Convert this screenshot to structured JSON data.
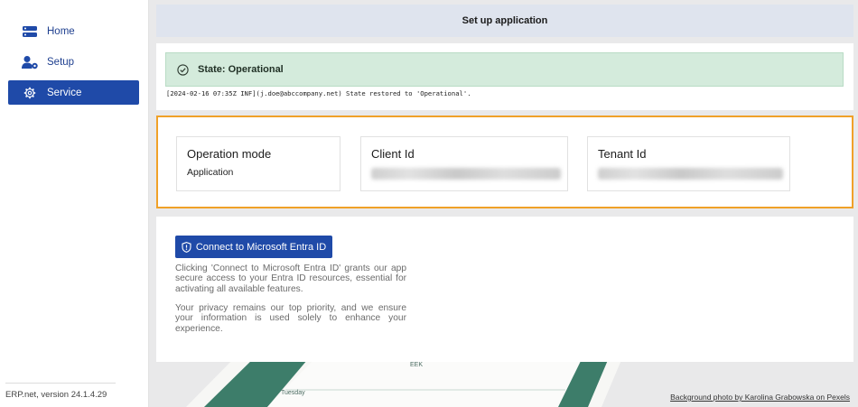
{
  "sidebar": {
    "items": [
      {
        "label": "Home",
        "icon": "server-icon"
      },
      {
        "label": "Setup",
        "icon": "user-gear-icon"
      },
      {
        "label": "Service",
        "icon": "gear-icon"
      }
    ],
    "version": "ERP.net, version 24.1.4.29"
  },
  "header": {
    "title": "Set up application"
  },
  "status": {
    "state_text": "State: Operational",
    "log": "[2024-02-16 07:35Z INF](j.doe@abccompany.net) State restored to 'Operational'."
  },
  "info": {
    "operation_mode": {
      "title": "Operation mode",
      "value": "Application"
    },
    "client_id": {
      "title": "Client Id"
    },
    "tenant_id": {
      "title": "Tenant Id"
    }
  },
  "connect": {
    "button_label": "Connect to Microsoft Entra ID",
    "paragraph1": "Clicking 'Connect to Microsoft Entra ID' grants our app secure access to your Entra ID resources, essential for activating all available features.",
    "paragraph2": "Your privacy remains our top priority, and we ensure your information is used solely to enhance your experience."
  },
  "credit": "Background photo by Karolina Grabowska on Pexels",
  "colors": {
    "accent": "#1f4aa8",
    "status_bg": "#d4ebdc",
    "highlight": "#f0a128"
  }
}
